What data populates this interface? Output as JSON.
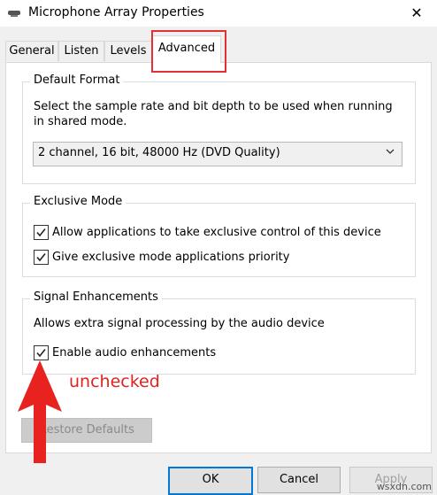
{
  "window": {
    "title": "Microphone Array Properties",
    "close_glyph": "✕"
  },
  "tabs": [
    {
      "label": "General",
      "active": false
    },
    {
      "label": "Listen",
      "active": false
    },
    {
      "label": "Levels",
      "active": false
    },
    {
      "label": "Advanced",
      "active": true
    }
  ],
  "default_format": {
    "legend": "Default Format",
    "description_line1": "Select the sample rate and bit depth to be used when running",
    "description_line2": "in shared mode.",
    "selected": "2 channel, 16 bit, 48000 Hz (DVD Quality)"
  },
  "exclusive_mode": {
    "legend": "Exclusive Mode",
    "options": [
      {
        "label": "Allow applications to take exclusive control of this device",
        "checked": true
      },
      {
        "label": "Give exclusive mode applications priority",
        "checked": true
      }
    ]
  },
  "signal_enhancements": {
    "legend": "Signal Enhancements",
    "description": "Allows extra signal processing by the audio device",
    "option": {
      "label": "Enable audio enhancements",
      "checked": true
    }
  },
  "annotation": {
    "text": "unchecked",
    "color": "#e0231f"
  },
  "buttons": {
    "restore_defaults": "Restore Defaults",
    "ok": "OK",
    "cancel": "Cancel",
    "apply": "Apply"
  },
  "watermark": "wsxdn.com",
  "colors": {
    "highlight": "#e33131",
    "focus": "#0078d7"
  }
}
